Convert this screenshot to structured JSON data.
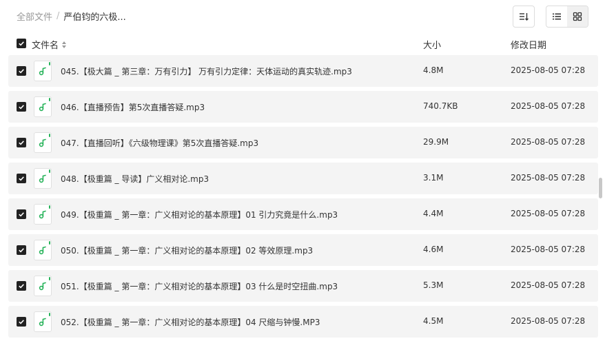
{
  "breadcrumb": {
    "root": "全部文件",
    "separator": "/",
    "current": "严伯钧的六极..."
  },
  "toolbar": {
    "sort_icon": "sort-icon",
    "list_view_icon": "list-view-icon",
    "grid_view_icon": "grid-view-icon",
    "active_view": "list"
  },
  "table": {
    "headers": {
      "name": "文件名",
      "size": "大小",
      "date": "修改日期"
    },
    "rows": [
      {
        "name": "045.【极大篇 _ 第三章：万有引力】 万有引力定律：天体运动的真实轨迹.mp3",
        "size": "4.8M",
        "date": "2025-08-05 07:28",
        "checked": true
      },
      {
        "name": "046.【直播预告】第5次直播答疑.mp3",
        "size": "740.7KB",
        "date": "2025-08-05 07:28",
        "checked": true
      },
      {
        "name": "047.【直播回听】《六级物理课》第5次直播答疑.mp3",
        "size": "29.9M",
        "date": "2025-08-05 07:28",
        "checked": true
      },
      {
        "name": "048.【极重篇 _ 导读】广义相对论.mp3",
        "size": "3.1M",
        "date": "2025-08-05 07:28",
        "checked": true
      },
      {
        "name": "049.【极重篇 _ 第一章：广义相对论的基本原理】01 引力究竟是什么.mp3",
        "size": "4.4M",
        "date": "2025-08-05 07:28",
        "checked": true
      },
      {
        "name": "050.【极重篇 _ 第一章：广义相对论的基本原理】02 等效原理.mp3",
        "size": "4.6M",
        "date": "2025-08-05 07:28",
        "checked": true
      },
      {
        "name": "051.【极重篇 _ 第一章：广义相对论的基本原理】03 什么是时空扭曲.mp3",
        "size": "5.3M",
        "date": "2025-08-05 07:28",
        "checked": true
      },
      {
        "name": "052.【极重篇 _ 第一章：广义相对论的基本原理】04 尺缩与钟慢.MP3",
        "size": "4.5M",
        "date": "2025-08-05 07:28",
        "checked": true
      }
    ]
  },
  "colors": {
    "accent_green": "#27b35a",
    "row_bg": "#f4f4f4",
    "checkbox": "#222222"
  }
}
